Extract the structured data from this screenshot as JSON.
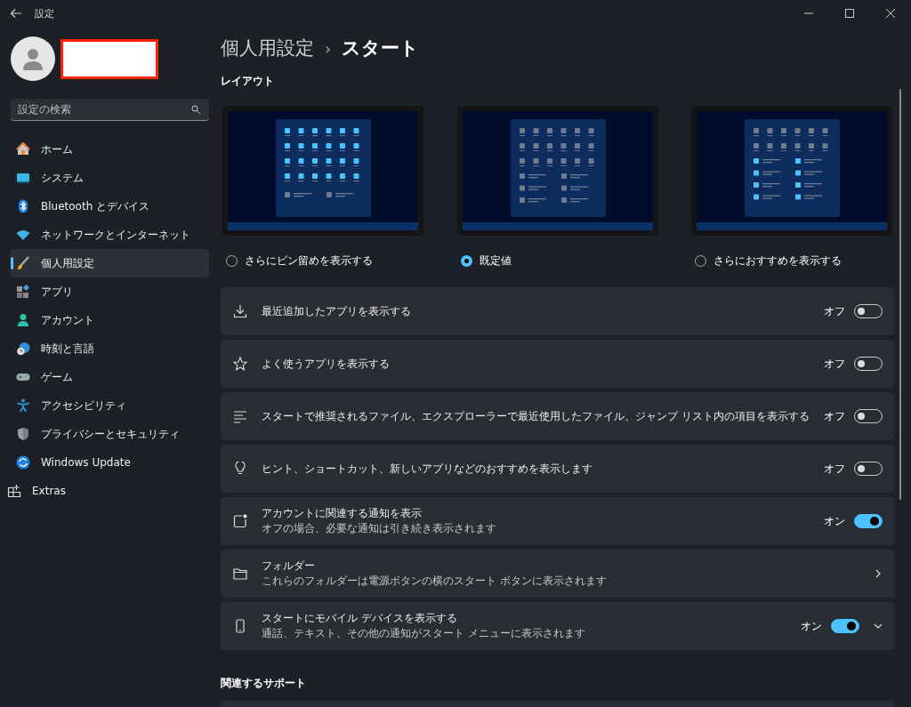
{
  "window": {
    "title": "設定"
  },
  "search": {
    "placeholder": "設定の検索"
  },
  "nav": [
    {
      "label": "ホーム",
      "selected": false
    },
    {
      "label": "システム",
      "selected": false
    },
    {
      "label": "Bluetooth とデバイス",
      "selected": false
    },
    {
      "label": "ネットワークとインターネット",
      "selected": false
    },
    {
      "label": "個人用設定",
      "selected": true
    },
    {
      "label": "アプリ",
      "selected": false
    },
    {
      "label": "アカウント",
      "selected": false
    },
    {
      "label": "時刻と言語",
      "selected": false
    },
    {
      "label": "ゲーム",
      "selected": false
    },
    {
      "label": "アクセシビリティ",
      "selected": false
    },
    {
      "label": "プライバシーとセキュリティ",
      "selected": false
    },
    {
      "label": "Windows Update",
      "selected": false
    }
  ],
  "extras": {
    "label": "Extras"
  },
  "breadcrumb": {
    "parent": "個人用設定",
    "separator": "›",
    "current": "スタート"
  },
  "layout_section": {
    "title": "レイアウト",
    "options": [
      {
        "kind": "more_pins",
        "label": "さらにピン留めを表示する",
        "selected": false
      },
      {
        "kind": "default",
        "label": "既定値",
        "selected": true
      },
      {
        "kind": "more_recs",
        "label": "さらにおすすめを表示する",
        "selected": false
      }
    ]
  },
  "settings": [
    {
      "kind": "toggle",
      "title": "最近追加したアプリを表示する",
      "state_text": "オフ",
      "on": false
    },
    {
      "kind": "toggle",
      "title": "よく使うアプリを表示する",
      "state_text": "オフ",
      "on": false
    },
    {
      "kind": "toggle",
      "title": "スタートで推奨されるファイル、エクスプローラーで最近使用したファイル、ジャンプ リスト内の項目を表示する",
      "state_text": "オフ",
      "on": false
    },
    {
      "kind": "toggle",
      "title": "ヒント、ショートカット、新しいアプリなどのおすすめを表示します",
      "state_text": "オフ",
      "on": false
    },
    {
      "kind": "toggle",
      "title": "アカウントに関連する通知を表示",
      "subtitle": "オフの場合、必要な通知は引き続き表示されます",
      "state_text": "オン",
      "on": true
    },
    {
      "kind": "link",
      "title": "フォルダー",
      "subtitle": "これらのフォルダーは電源ボタンの横のスタート ボタンに表示されます"
    },
    {
      "kind": "toggle_expand",
      "title": "スタートにモバイル デバイスを表示する",
      "subtitle": "通話、テキスト、その他の通知がスタート メニューに表示されます",
      "state_text": "オン",
      "on": true
    }
  ],
  "related": {
    "title": "関連するサポート"
  }
}
